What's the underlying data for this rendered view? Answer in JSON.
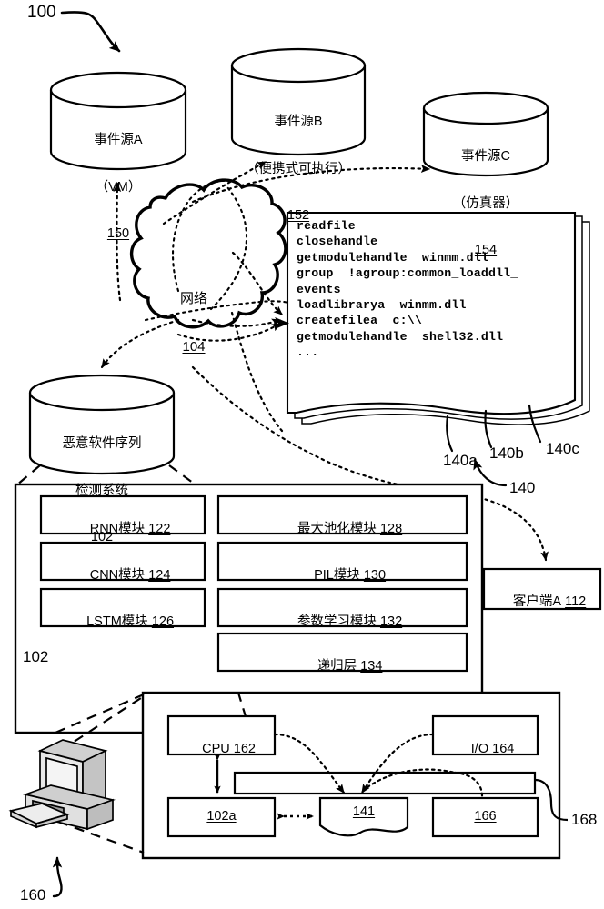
{
  "figure": {
    "number": "100",
    "bottom_ref": "160",
    "dashed_callouts": [
      "140a",
      "140b",
      "140c",
      "140"
    ],
    "hardware_ref": "168"
  },
  "event_sources": [
    {
      "name": "event-source-a",
      "line1": "事件源A",
      "line2": "（VM）",
      "ref": "150"
    },
    {
      "name": "event-source-b",
      "line1": "事件源B",
      "line2": "（便携式可执行）",
      "ref": "152"
    },
    {
      "name": "event-source-c",
      "line1": "事件源C",
      "line2": "（仿真器）",
      "ref": "154"
    }
  ],
  "network": {
    "label": "网络",
    "ref": "104"
  },
  "detection_system": {
    "line1": "恶意软件序列",
    "line2": "检测系统",
    "ref": "102"
  },
  "event_log": {
    "lines": [
      "readfile",
      "closehandle",
      "getmodulehandle  winmm.dll",
      "group  !agroup:common_loaddll_",
      "events",
      "loadlibrarya  winmm.dll",
      "createfilea  c:\\\\",
      "getmodulehandle  shell32.dll",
      "..."
    ],
    "stack_refs": {
      "front": "140a",
      "middle": "140b",
      "back": "140c",
      "group": "140"
    }
  },
  "client": {
    "label": "客户端A",
    "ref": "112"
  },
  "modules_container": {
    "ref": "102"
  },
  "modules": {
    "left_column": [
      {
        "name": "rnn-module",
        "label": "RNN模块",
        "ref": "122"
      },
      {
        "name": "cnn-module",
        "label": "CNN模块",
        "ref": "124"
      },
      {
        "name": "lstm-module",
        "label": "LSTM模块",
        "ref": "126"
      }
    ],
    "right_column": [
      {
        "name": "max-pooling-module",
        "label": "最大池化模块",
        "ref": "128"
      },
      {
        "name": "pil-module",
        "label": "PIL模块",
        "ref": "130"
      },
      {
        "name": "parameter-learning-module",
        "label": "参数学习模块",
        "ref": "132"
      },
      {
        "name": "recurrent-layer",
        "label": "递归层",
        "ref": "134"
      }
    ]
  },
  "hardware": {
    "cpu": {
      "label": "CPU",
      "ref": "162"
    },
    "io": {
      "label": "I/O",
      "ref": "164"
    },
    "memory_module": {
      "label": "",
      "ref": "102a"
    },
    "data_block": {
      "label": "",
      "ref": "141"
    },
    "storage": {
      "label": "",
      "ref": "166"
    },
    "bus_ref": "168"
  }
}
